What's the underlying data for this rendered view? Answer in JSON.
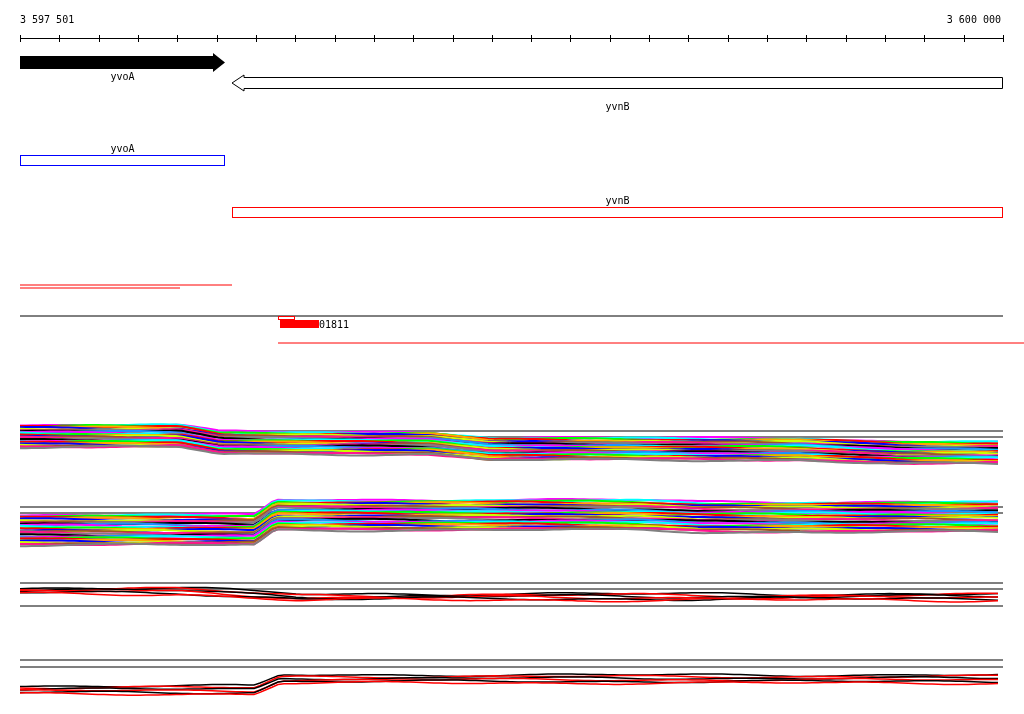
{
  "ruler": {
    "start": "3 597 501",
    "end": "3 600 000"
  },
  "genes": [
    {
      "name": "yvoA",
      "reverse": false
    },
    {
      "name": "yvnB",
      "reverse": true
    }
  ],
  "annotations": [
    {
      "name": "yvoA",
      "color": "#0000ff"
    },
    {
      "name": "yvnB",
      "color": "#ff0000"
    }
  ],
  "feature": {
    "label": "01811"
  }
}
